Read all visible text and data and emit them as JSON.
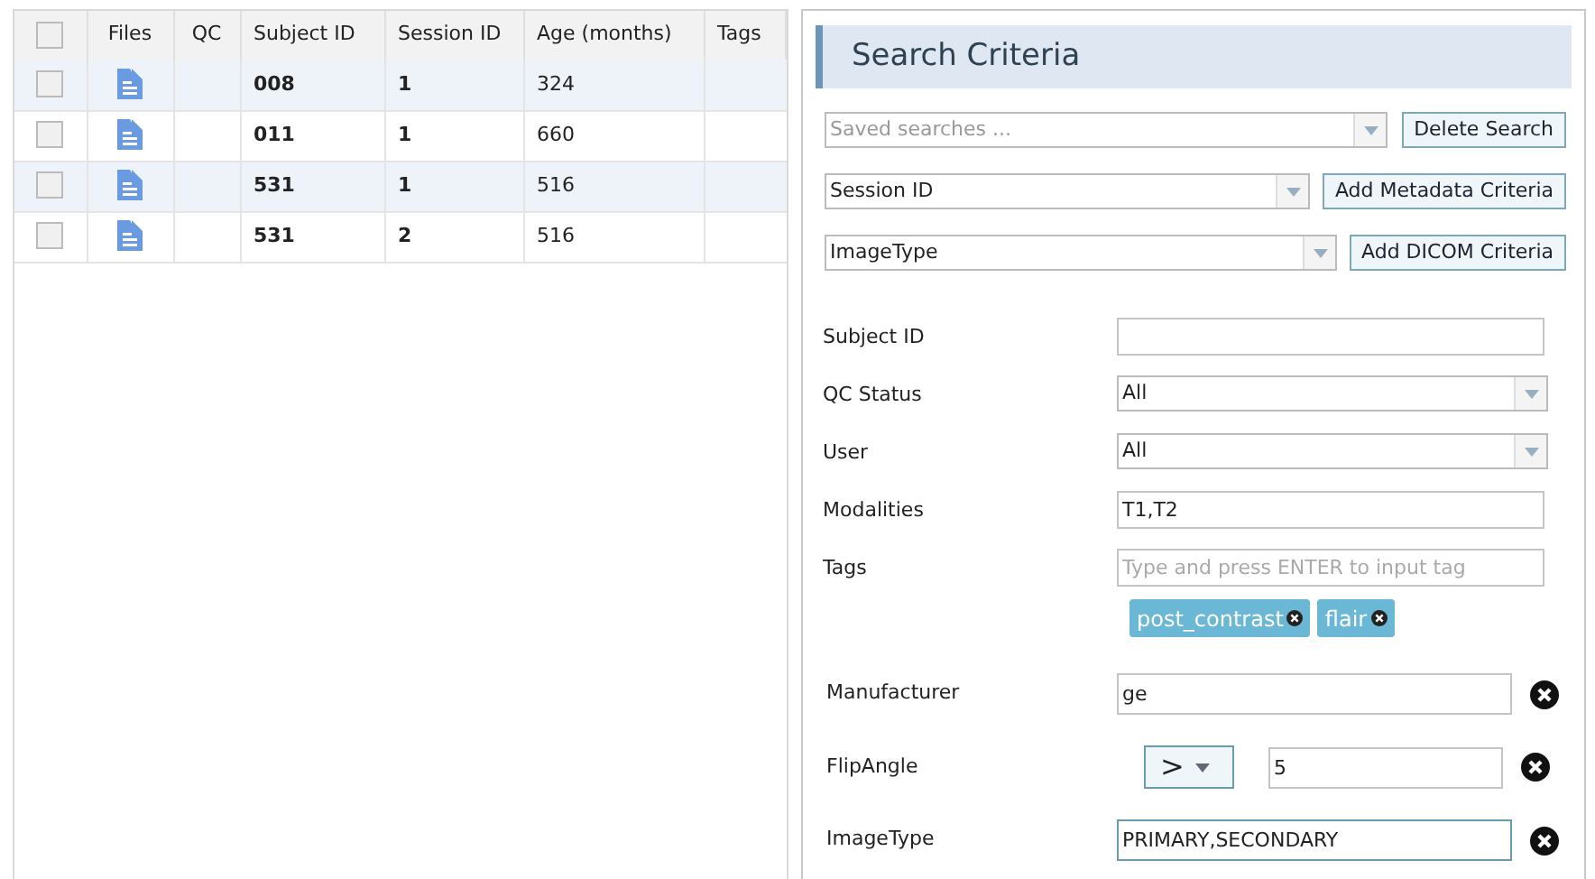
{
  "table": {
    "select_all": {
      "checked": false
    },
    "columns": [
      "Files",
      "QC",
      "Subject ID",
      "Session ID",
      "Age (months)",
      "Tags"
    ],
    "rows": [
      {
        "checked": false,
        "subject_id": "008",
        "session_id": "1",
        "age": "324"
      },
      {
        "checked": false,
        "subject_id": "011",
        "session_id": "1",
        "age": "660"
      },
      {
        "checked": false,
        "subject_id": "531",
        "session_id": "1",
        "age": "516"
      },
      {
        "checked": false,
        "subject_id": "531",
        "session_id": "2",
        "age": "516"
      }
    ]
  },
  "search_panel": {
    "title": "Search Criteria",
    "saved_search": {
      "placeholder": "Saved searches ...",
      "button": "Delete Search"
    },
    "metadata": {
      "value": "Session ID",
      "button": "Add Metadata Criteria"
    },
    "dicom": {
      "value": "ImageType",
      "button": "Add DICOM Criteria"
    },
    "fields": [
      {
        "kind": "text",
        "label": "Subject ID"
      },
      {
        "kind": "select",
        "label": "QC Status",
        "value": "All"
      },
      {
        "kind": "select",
        "label": "User",
        "value": "All"
      },
      {
        "kind": "text",
        "label": "Modalities",
        "value": "T1,T2"
      },
      {
        "kind": "tags",
        "label": "Tags",
        "placeholder": "Type and press ENTER to input tag",
        "tags": [
          "post_contrast",
          "flair"
        ]
      }
    ],
    "criteria": [
      {
        "kind": "text",
        "label": "Manufacturer",
        "value": "ge"
      },
      {
        "kind": "operator",
        "label": "FlipAngle",
        "operator": ">",
        "value": "5"
      },
      {
        "kind": "text",
        "label": "ImageType",
        "value": "PRIMARY,SECONDARY",
        "focused": true
      }
    ]
  }
}
